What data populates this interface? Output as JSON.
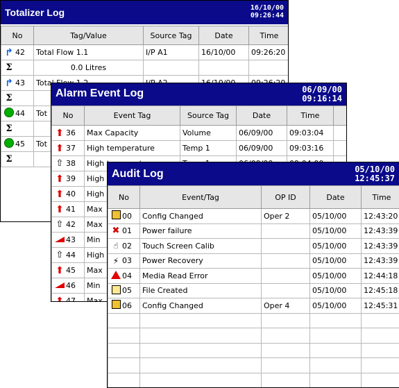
{
  "totalizer": {
    "title": "Totalizer Log",
    "date": "16/10/00",
    "time": "09:26:44",
    "columns": [
      "No",
      "Tag/Value",
      "Source Tag",
      "Date",
      "Time"
    ],
    "rows": [
      {
        "icon": "blue-arrow-icon",
        "no": "42",
        "tag": "Total Flow 1.1",
        "source": "I/P A1",
        "date": "16/10/00",
        "time": "09:26:20"
      },
      {
        "icon": "sigma-icon",
        "no": "",
        "tag": "0.0  Litres",
        "source": "",
        "date": "",
        "time": ""
      },
      {
        "icon": "blue-arrow-icon",
        "no": "43",
        "tag": "Total Flow 1.2",
        "source": "I/P A2",
        "date": "16/10/00",
        "time": "09:26:20"
      },
      {
        "icon": "sigma-icon",
        "no": "",
        "tag": "",
        "source": "",
        "date": "",
        "time": ""
      },
      {
        "icon": "green-dot-icon",
        "no": "44",
        "tag": "Tot",
        "source": "",
        "date": "",
        "time": ""
      },
      {
        "icon": "sigma-icon",
        "no": "",
        "tag": "",
        "source": "",
        "date": "",
        "time": ""
      },
      {
        "icon": "green-dot-icon",
        "no": "45",
        "tag": "Tot",
        "source": "",
        "date": "",
        "time": ""
      },
      {
        "icon": "sigma-icon",
        "no": "",
        "tag": "",
        "source": "",
        "date": "",
        "time": ""
      }
    ]
  },
  "alarm": {
    "title": "Alarm Event Log",
    "date": "06/09/00",
    "time": "09:16:14",
    "columns": [
      "No",
      "Event Tag",
      "Source Tag",
      "Date",
      "Time"
    ],
    "rows": [
      {
        "icon": "red-flash-up-icon",
        "no": "36",
        "tag": "Max Capacity",
        "source": "Volume",
        "date": "06/09/00",
        "time": "09:03:04"
      },
      {
        "icon": "red-up-arrow-icon",
        "no": "37",
        "tag": "High temperature",
        "source": "Temp 1",
        "date": "06/09/00",
        "time": "09:03:16"
      },
      {
        "icon": "hollow-up-arrow-icon",
        "no": "38",
        "tag": "High temperature",
        "source": "Temp 1",
        "date": "06/09/00",
        "time": "09:04:00"
      },
      {
        "icon": "red-up-arrow-icon",
        "no": "39",
        "tag": "High",
        "source": "",
        "date": "",
        "time": ""
      },
      {
        "icon": "red-up-arrow-icon",
        "no": "40",
        "tag": "High",
        "source": "",
        "date": "",
        "time": ""
      },
      {
        "icon": "red-flash-up-icon",
        "no": "41",
        "tag": "Max",
        "source": "",
        "date": "",
        "time": ""
      },
      {
        "icon": "hollow-flash-up-icon",
        "no": "42",
        "tag": "Max",
        "source": "",
        "date": "",
        "time": ""
      },
      {
        "icon": "red-ramp-icon",
        "no": "43",
        "tag": "Min",
        "source": "",
        "date": "",
        "time": ""
      },
      {
        "icon": "hollow-up-arrow-icon",
        "no": "44",
        "tag": "High",
        "source": "",
        "date": "",
        "time": ""
      },
      {
        "icon": "red-flash-up-icon",
        "no": "45",
        "tag": "Max",
        "source": "",
        "date": "",
        "time": ""
      },
      {
        "icon": "red-ramp-icon",
        "no": "46",
        "tag": "Min",
        "source": "",
        "date": "",
        "time": ""
      },
      {
        "icon": "red-flash-up-icon",
        "no": "47",
        "tag": "Max",
        "source": "",
        "date": "",
        "time": ""
      }
    ]
  },
  "audit": {
    "title": "Audit Log",
    "date": "05/10/00",
    "time": "12:45:37",
    "columns": [
      "No",
      "Event/Tag",
      "OP ID",
      "Date",
      "Time"
    ],
    "rows": [
      {
        "icon": "config-icon",
        "no": "00",
        "tag": "Config Changed",
        "opid": "Oper 2",
        "date": "05/10/00",
        "time": "12:43:20"
      },
      {
        "icon": "power-failure-icon",
        "no": "01",
        "tag": "Power failure",
        "opid": "",
        "date": "05/10/00",
        "time": "12:43:39"
      },
      {
        "icon": "touch-hand-icon",
        "no": "02",
        "tag": "Touch Screen Calib",
        "opid": "",
        "date": "05/10/00",
        "time": "12:43:39"
      },
      {
        "icon": "power-plug-icon",
        "no": "03",
        "tag": "Power Recovery",
        "opid": "",
        "date": "05/10/00",
        "time": "12:43:39"
      },
      {
        "icon": "warning-icon",
        "no": "04",
        "tag": "Media Read Error",
        "opid": "",
        "date": "05/10/00",
        "time": "12:44:18"
      },
      {
        "icon": "new-file-icon",
        "no": "05",
        "tag": "File Created",
        "opid": "",
        "date": "05/10/00",
        "time": "12:45:18"
      },
      {
        "icon": "config-icon",
        "no": "06",
        "tag": "Config Changed",
        "opid": "Oper 4",
        "date": "05/10/00",
        "time": "12:45:31"
      },
      {
        "icon": "",
        "no": "",
        "tag": "",
        "opid": "",
        "date": "",
        "time": ""
      },
      {
        "icon": "",
        "no": "",
        "tag": "",
        "opid": "",
        "date": "",
        "time": ""
      },
      {
        "icon": "",
        "no": "",
        "tag": "",
        "opid": "",
        "date": "",
        "time": ""
      },
      {
        "icon": "",
        "no": "",
        "tag": "",
        "opid": "",
        "date": "",
        "time": ""
      },
      {
        "icon": "",
        "no": "",
        "tag": "",
        "opid": "",
        "date": "",
        "time": ""
      }
    ]
  }
}
